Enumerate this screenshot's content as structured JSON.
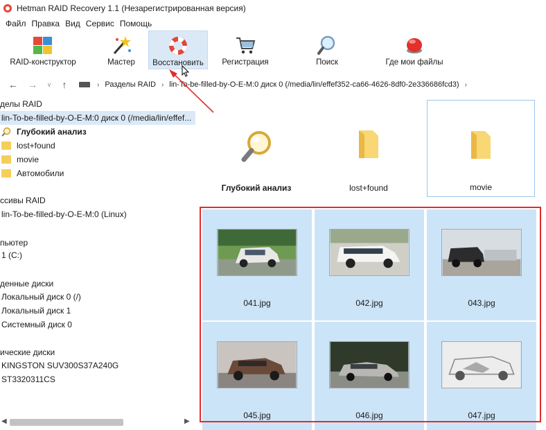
{
  "window": {
    "title": "Hetman RAID Recovery 1.1 (Незарегистрированная версия)"
  },
  "menu": [
    "Файл",
    "Правка",
    "Вид",
    "Сервис",
    "Помощь"
  ],
  "toolbar": {
    "raid_builder": "RAID-конструктор",
    "wizard": "Мастер",
    "restore": "Восстановить",
    "register": "Регистрация",
    "search": "Поиск",
    "where_files": "Где мои файлы"
  },
  "address": {
    "crumb1": "Разделы RAID",
    "crumb2": "lin-To-be-filled-by-O-E-M:0 диск 0 (/media/lin/effef352-ca66-4626-8df0-2e336686fcd3)"
  },
  "tree": {
    "section_raid_partitions": "делы RAID",
    "disk0": "lin-To-be-filled-by-O-E-M:0 диск 0 (/media/lin/effef...",
    "deep_analysis": "Глубокий анализ",
    "lost_found": "lost+found",
    "movie": "movie",
    "auto": "Автомобили",
    "section_raid_arrays": "ссивы RAID",
    "raid_array": "lin-To-be-filled-by-O-E-M:0 (Linux)",
    "section_computer": "пьютер",
    "drive_c": "1 (C:)",
    "section_mounted": "денные диски",
    "local0": "Локальный диск 0 (/)",
    "local1": "Локальный диск 1",
    "system0": "Системный диск 0",
    "section_physical": "ические диски",
    "kingston": "KINGSTON SUV300S37A240G",
    "st": "ST3320311CS"
  },
  "files": {
    "deep_analysis": "Глубокий анализ",
    "lost_found": "lost+found",
    "movie": "movie",
    "img1": "041.jpg",
    "img2": "042.jpg",
    "img3": "043.jpg",
    "img4": "045.jpg",
    "img5": "046.jpg",
    "img6": "047.jpg"
  },
  "colors": {
    "selection": "#cce4f7",
    "highlight_border": "#e32b2b",
    "folder": "#f6cf5a"
  }
}
